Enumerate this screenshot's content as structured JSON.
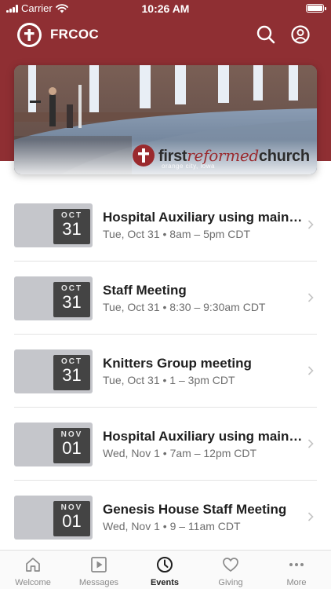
{
  "status_bar": {
    "carrier": "Carrier",
    "time": "10:26 AM"
  },
  "header": {
    "title": "FRCOC",
    "brand_color": "#8f2f33"
  },
  "banner": {
    "logo_text_1": "first",
    "logo_text_2": "reformed",
    "logo_text_3": "church",
    "logo_sub": "orange city, iowa"
  },
  "events": [
    {
      "month": "OCT",
      "day": "31",
      "title": "Hospital Auxiliary using main k...",
      "time": "Tue, Oct 31 • 8am – 5pm CDT"
    },
    {
      "month": "OCT",
      "day": "31",
      "title": "Staff Meeting",
      "time": "Tue, Oct 31 • 8:30 – 9:30am CDT"
    },
    {
      "month": "OCT",
      "day": "31",
      "title": "Knitters Group meeting",
      "time": "Tue, Oct 31 • 1 – 3pm CDT"
    },
    {
      "month": "NOV",
      "day": "01",
      "title": "Hospital Auxiliary using main k...",
      "time": "Wed, Nov 1 • 7am – 12pm CDT"
    },
    {
      "month": "NOV",
      "day": "01",
      "title": "Genesis House Staff Meeting",
      "time": "Wed, Nov 1 • 9 – 11am CDT"
    }
  ],
  "tabs": [
    {
      "label": "Welcome",
      "icon": "home-icon"
    },
    {
      "label": "Messages",
      "icon": "play-icon"
    },
    {
      "label": "Events",
      "icon": "clock-icon",
      "active": true
    },
    {
      "label": "Giving",
      "icon": "heart-icon"
    },
    {
      "label": "More",
      "icon": "more-dots-icon"
    }
  ]
}
